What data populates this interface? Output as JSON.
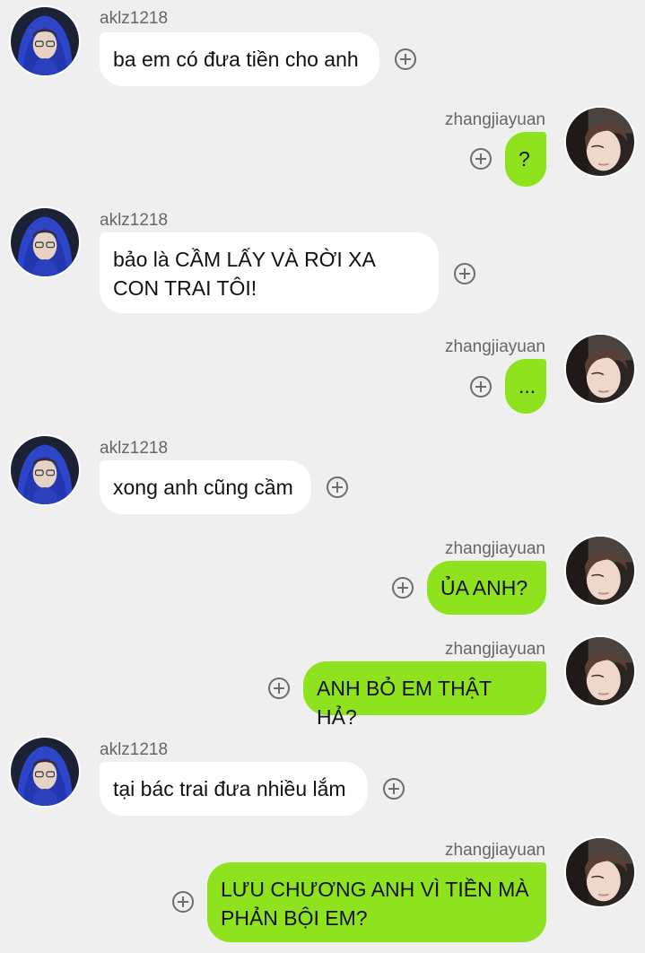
{
  "messages": [
    {
      "sender": "aklz1218",
      "side": "left",
      "text": "ba em có đưa tiền cho anh"
    },
    {
      "sender": "zhangjiayuan",
      "side": "right",
      "text": "?"
    },
    {
      "sender": "aklz1218",
      "side": "left",
      "text": "bảo là CẦM LẤY VÀ RỜI XA CON TRAI TÔI!"
    },
    {
      "sender": "zhangjiayuan",
      "side": "right",
      "text": "..."
    },
    {
      "sender": "aklz1218",
      "side": "left",
      "text": "xong anh cũng cầm"
    },
    {
      "sender": "zhangjiayuan",
      "side": "right",
      "text": "ỦA ANH?"
    },
    {
      "sender": "zhangjiayuan",
      "side": "right",
      "text": "ANH BỎ EM THẬT HẢ?"
    },
    {
      "sender": "aklz1218",
      "side": "left",
      "text": "tại bác trai đưa nhiều lắm"
    },
    {
      "sender": "zhangjiayuan",
      "side": "right",
      "text": "LƯU CHƯƠNG ANH VÌ TIỀN MÀ PHẢN BỘI EM?"
    }
  ],
  "colors": {
    "background": "#efefef",
    "left_bubble": "#ffffff",
    "right_bubble": "#8fe31e"
  },
  "icons": {
    "add": "plus-circle-icon"
  }
}
